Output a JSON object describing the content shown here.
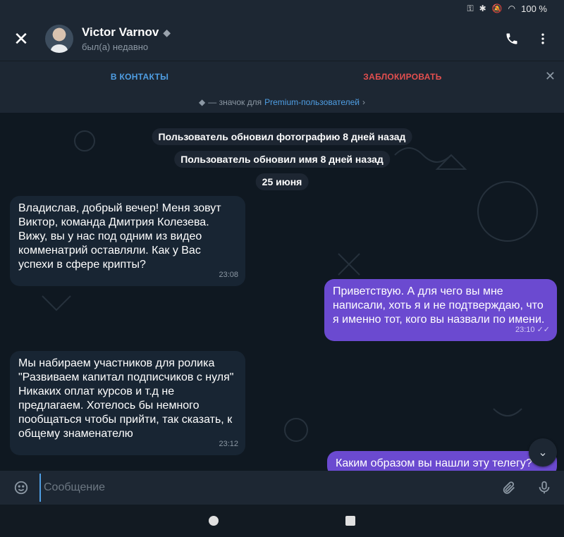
{
  "status": {
    "battery": "100 %"
  },
  "header": {
    "name": "Victor Varnov",
    "last_seen": "был(а) недавно"
  },
  "actions": {
    "add_contact": "В КОНТАКТЫ",
    "block": "ЗАБЛОКИРОВАТЬ"
  },
  "premium": {
    "prefix": "— значок для",
    "link": "Premium-пользователей"
  },
  "chat": {
    "service": [
      "Пользователь обновил фотографию 8 дней назад",
      "Пользователь обновил имя 8 дней назад",
      "25 июня"
    ],
    "messages": [
      {
        "text": "Владислав, добрый вечер! Меня зовут Виктор, команда Дмитрия Колезева. Вижу, вы у нас под одним из видео комменатрий оставляли. Как у Вас успехи в сфере крипты?",
        "time": "23:08"
      },
      {
        "text": "Приветствую. А для чего вы мне написали, хоть я и не подтверждаю, что я именно тот, кого вы назвали по имени.",
        "time": "23:10"
      },
      {
        "text": "Мы набираем участников для ролика \"Развиваем капитал подписчиков с нуля\" Никаких оплат курсов и т.д не предлагаем. Хотелось бы немного пообщаться чтобы прийти, так сказать, к общему знаменателю",
        "time": "23:12"
      },
      {
        "text": "Каким образом вы нашли эту телегу?",
        "time": ""
      }
    ]
  },
  "input": {
    "placeholder": "Сообщение"
  },
  "colors": {
    "accent": "#4f9ee3",
    "danger": "#e34f4f",
    "outgoing": "#6b4ad0"
  }
}
